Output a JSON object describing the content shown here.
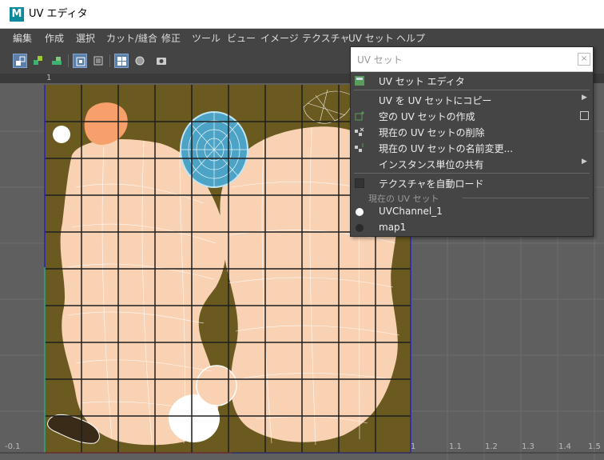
{
  "window": {
    "logo": "M",
    "title": "UV エディタ"
  },
  "menu": [
    "編集",
    "作成",
    "選択",
    "カット/縫合",
    "修正",
    "ツール",
    "ビュー",
    "イメージ",
    "テクスチャ",
    "UV セット",
    "ヘルプ"
  ],
  "toolbar": {
    "icons": [
      "uv-shell-select-icon",
      "uv-shell-isolate-icon",
      "uv-shell-tile-icon",
      "display-grid-icon",
      "display-frame-icon",
      "checker-map-icon",
      "shaded-uv-icon",
      "snapshot-icon"
    ]
  },
  "ruler": {
    "top_label": "1"
  },
  "viewport": {
    "axis_labels": [
      "-0.1",
      "1",
      "1.1",
      "1.2",
      "1.3",
      "1.4",
      "1.5"
    ]
  },
  "dropdown": {
    "title": "UV セット",
    "close": "×",
    "items": [
      {
        "label": "UV セット エディタ",
        "icon": "uv-set-editor-icon"
      },
      {
        "label": "UV を UV セットにコピー",
        "submenu": "▶"
      },
      {
        "label": "空の UV セットの作成",
        "checkbox": true,
        "icon": "create-empty-uv-set-icon"
      },
      {
        "label": "現在の UV セットの削除",
        "icon": "delete-uv-set-icon"
      },
      {
        "label": "現在の UV セットの名前変更...",
        "icon": "rename-uv-set-icon"
      },
      {
        "label": "インスタンス単位の共有",
        "submenu": "▶"
      },
      {
        "label": "テクスチャを自動ロード",
        "icon": "auto-load-texture-icon"
      }
    ],
    "section_label": "現在の UV セット",
    "uv_sets": [
      {
        "label": "UVChannel_1",
        "selected": true
      },
      {
        "label": "map1",
        "selected": false
      }
    ]
  },
  "colors": {
    "texture_bg": "#6b5a1f",
    "shell_fill": "#f9d2b4",
    "grid_line": "#1e1e1e",
    "uv_line": "#ffffff",
    "menu_bg": "#454545",
    "accent": "#5b7fa8",
    "dome": "#4da3c6",
    "orange": "#f7a06b"
  }
}
